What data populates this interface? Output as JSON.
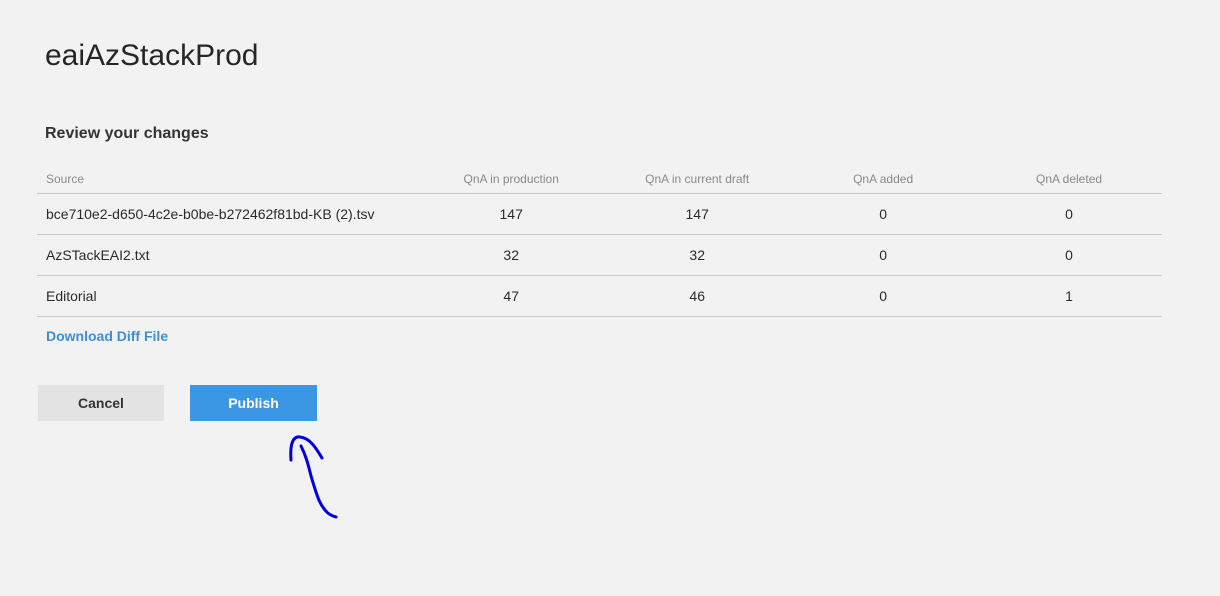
{
  "kb_title": "eaiAzStackProd",
  "review": {
    "title": "Review your changes",
    "columns": {
      "source": "Source",
      "production": "QnA in production",
      "draft": "QnA in current draft",
      "added": "QnA added",
      "deleted": "QnA deleted"
    },
    "rows": [
      {
        "source": "bce710e2-d650-4c2e-b0be-b272462f81bd-KB (2).tsv",
        "production": "147",
        "draft": "147",
        "added": "0",
        "deleted": "0"
      },
      {
        "source": "AzSTackEAI2.txt",
        "production": "32",
        "draft": "32",
        "added": "0",
        "deleted": "0"
      },
      {
        "source": "Editorial",
        "production": "47",
        "draft": "46",
        "added": "0",
        "deleted": "1"
      }
    ]
  },
  "download_link": "Download Diff File",
  "buttons": {
    "cancel": "Cancel",
    "publish": "Publish"
  },
  "colors": {
    "accent": "#3b97e3",
    "link": "#3e8fd6",
    "annotation": "#0000dd"
  }
}
